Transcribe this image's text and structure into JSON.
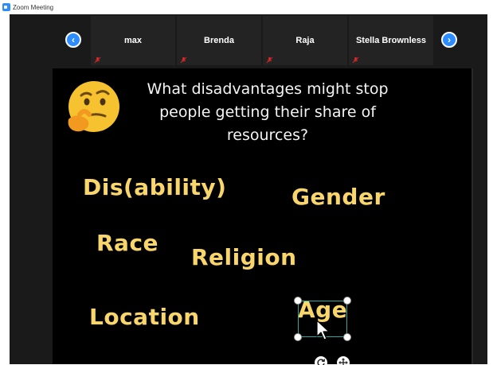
{
  "window": {
    "title": "Zoom Meeting",
    "app_icon": "zoom-icon"
  },
  "participants": [
    {
      "name": "max",
      "muted": true
    },
    {
      "name": "Brenda",
      "muted": true
    },
    {
      "name": "Raja",
      "muted": true
    },
    {
      "name": "Stella Brownless",
      "muted": true
    }
  ],
  "navigation": {
    "prev_icon": "chevron-left-icon",
    "next_icon": "chevron-right-icon",
    "accent": "#2d8cff"
  },
  "share": {
    "emoji": "thinking-face-icon",
    "question": "What disadvantages might stop people getting their share of resources?",
    "words": {
      "disability": "Dis(ability)",
      "gender": "Gender",
      "race": "Race",
      "religion": "Religion",
      "location": "Location",
      "age": "Age"
    },
    "word_color": "#f9d66b",
    "selected_word": "Age",
    "selection_color": "#2aa9a0",
    "controls": {
      "rotate_icon": "rotate-icon",
      "move_icon": "move-icon"
    }
  }
}
